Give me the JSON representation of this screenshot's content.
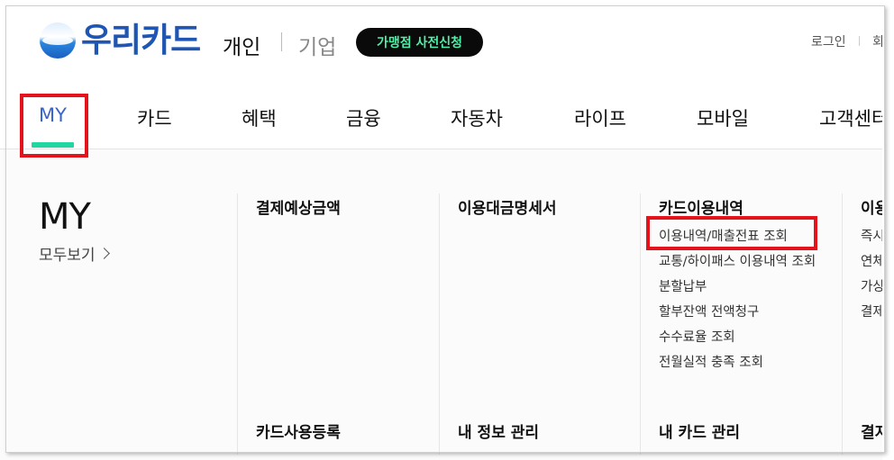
{
  "header": {
    "logo_text": "우리카드",
    "tab_personal": "개인",
    "tab_corporate": "기업",
    "merchant_button": "가맹점 사전신청",
    "login": "로그인",
    "join_partial": "회"
  },
  "nav": {
    "items": [
      "MY",
      "카드",
      "혜택",
      "금융",
      "자동차",
      "라이프",
      "모바일",
      "고객센터"
    ],
    "active": "MY"
  },
  "mega": {
    "my_title": "MY",
    "view_all": "모두보기",
    "categories": {
      "payment_due": "결제예상금액",
      "statement": "이용대금명세서",
      "card_usage": "카드이용내역",
      "col4_partial": "이용",
      "card_register": "카드사용등록",
      "my_info": "내 정보 관리",
      "my_card": "내 카드 관리",
      "col4_bottom_partial": "결지"
    },
    "card_usage_items": [
      "이용내역/매출전표 조회",
      "교통/하이패스 이용내역 조회",
      "분할납부",
      "할부잔액 전액청구",
      "수수료율 조회",
      "전월실적 충족 조회"
    ],
    "col4_items_partial": [
      "즉시",
      "연체",
      "가상",
      "결제"
    ]
  },
  "colors": {
    "brand_blue": "#1f56b3",
    "accent_green": "#22d6a1",
    "highlight_red": "#e3121b",
    "button_bg": "#0a0a0a",
    "button_text": "#4ff0a8"
  }
}
